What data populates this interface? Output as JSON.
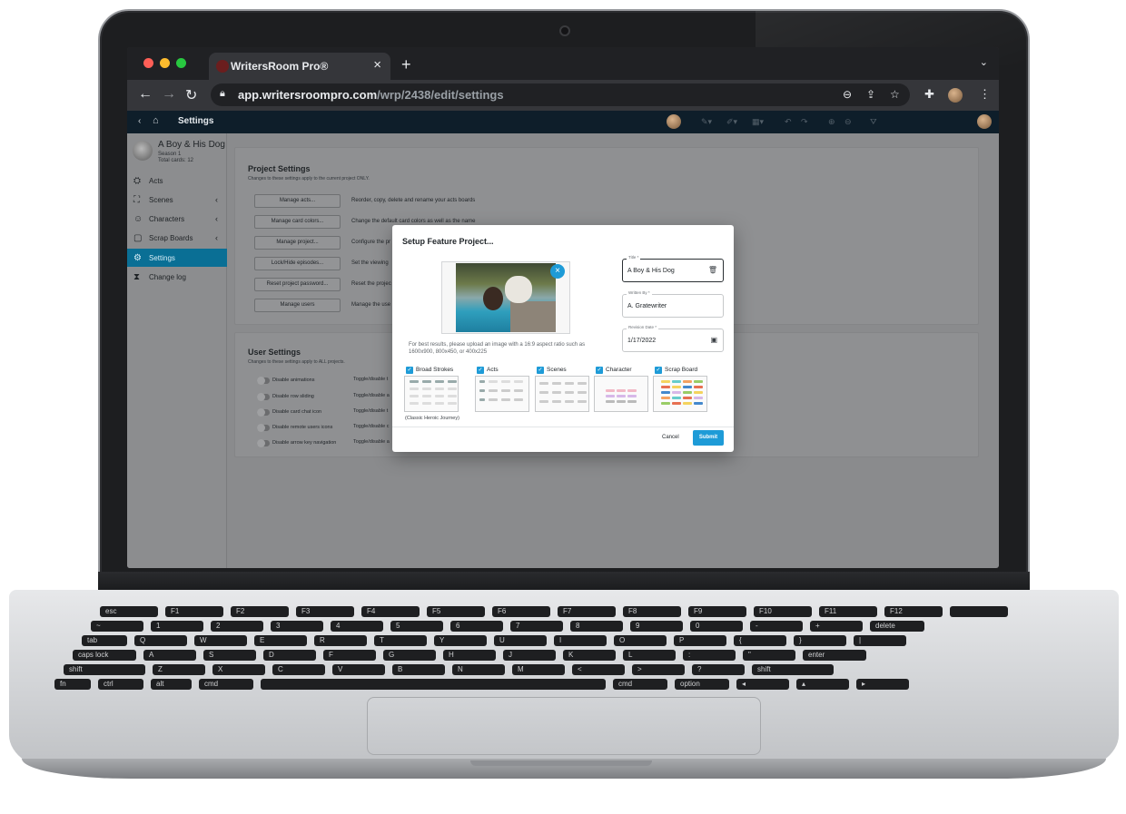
{
  "browser": {
    "tab_title": "WritersRoom Pro®",
    "tab_close": "×",
    "new_tab": "+",
    "tab_menu": "⌄",
    "url_host": "app.writersroompro.com",
    "url_path": "/wrp/2438/edit/settings"
  },
  "app": {
    "breadcrumb": "Settings",
    "project": {
      "name": "A Boy & His Dog",
      "season": "Season 1",
      "total_cards": "Total cards: 12"
    },
    "sidebar": [
      {
        "label": "Acts",
        "icon": "⛭",
        "chevron": ""
      },
      {
        "label": "Scenes",
        "icon": "⛶",
        "chevron": "‹"
      },
      {
        "label": "Characters",
        "icon": "☺",
        "chevron": "‹"
      },
      {
        "label": "Scrap Boards",
        "icon": "▢",
        "chevron": "‹"
      },
      {
        "label": "Settings",
        "icon": "⚙",
        "chevron": ""
      },
      {
        "label": "Change log",
        "icon": "⧗",
        "chevron": ""
      }
    ],
    "project_settings": {
      "title": "Project Settings",
      "subtitle": "Changes to these settings apply to the current project ONLY.",
      "rows": [
        {
          "button": "Manage acts...",
          "desc": "Reorder, copy, delete and rename your acts boards"
        },
        {
          "button": "Manage card colors...",
          "desc": "Change the default card colors as well as the name"
        },
        {
          "button": "Manage project...",
          "desc": "Configure the pr"
        },
        {
          "button": "Lock/Hide episodes...",
          "desc": "Set the viewing"
        },
        {
          "button": "Reset project password...",
          "desc": "Reset the projec"
        },
        {
          "button": "Manage users",
          "desc": "Manage the use"
        }
      ]
    },
    "user_settings": {
      "title": "User Settings",
      "subtitle": "Changes to these settings apply to ALL projects.",
      "rows": [
        {
          "label": "Disable animations",
          "desc": "Toggle/disable t"
        },
        {
          "label": "Disable row sliding",
          "desc": "Toggle/disable a"
        },
        {
          "label": "Disable card chat icon",
          "desc": "Toggle/disable t"
        },
        {
          "label": "Disable remote users icons",
          "desc": "Toggle/disable c"
        },
        {
          "label": "Disable arrow key navigation",
          "desc": "Toggle/disable a"
        }
      ]
    }
  },
  "modal": {
    "title": "Setup Feature Project...",
    "photo_close": "×",
    "hint": "For best results, please upload an image with a 16:9 aspect ratio such as 1600x900, 800x450, or 400x225",
    "fields": {
      "title_label": "Title *",
      "title_value": "A Boy & His Dog",
      "written_label": "Written By *",
      "written_value": "A. Gratewriter",
      "date_label": "Revision Date *",
      "date_value": "1/17/2022"
    },
    "templates": [
      {
        "name": "Broad Strokes"
      },
      {
        "name": "Acts"
      },
      {
        "name": "Scenes"
      },
      {
        "name": "Character"
      },
      {
        "name": "Scrap Board"
      }
    ],
    "classic_label": "(Classic Heroic Journey)",
    "cancel": "Cancel",
    "submit": "Submit"
  },
  "keyboard": {
    "row1": [
      "esc",
      "F1",
      "F2",
      "F3",
      "F4",
      "F5",
      "F6",
      "F7",
      "F8",
      "F9",
      "F10",
      "F11",
      "F12",
      ""
    ],
    "row2": [
      "~",
      "1",
      "2",
      "3",
      "4",
      "5",
      "6",
      "7",
      "8",
      "9",
      "0",
      "-",
      "+",
      "delete"
    ],
    "row3": [
      "tab",
      "Q",
      "W",
      "E",
      "R",
      "T",
      "Y",
      "U",
      "I",
      "O",
      "P",
      "{",
      "}",
      "|"
    ],
    "row4": [
      "caps lock",
      "A",
      "S",
      "D",
      "F",
      "G",
      "H",
      "J",
      "K",
      "L",
      ":",
      "\"",
      "enter"
    ],
    "row5": [
      "shift",
      "Z",
      "X",
      "C",
      "V",
      "B",
      "N",
      "M",
      "<",
      ">",
      "?",
      "shift"
    ],
    "row6": [
      "fn",
      "ctrl",
      "alt",
      "cmd",
      "",
      "cmd",
      "option",
      "◂",
      "▴",
      "▸"
    ]
  }
}
